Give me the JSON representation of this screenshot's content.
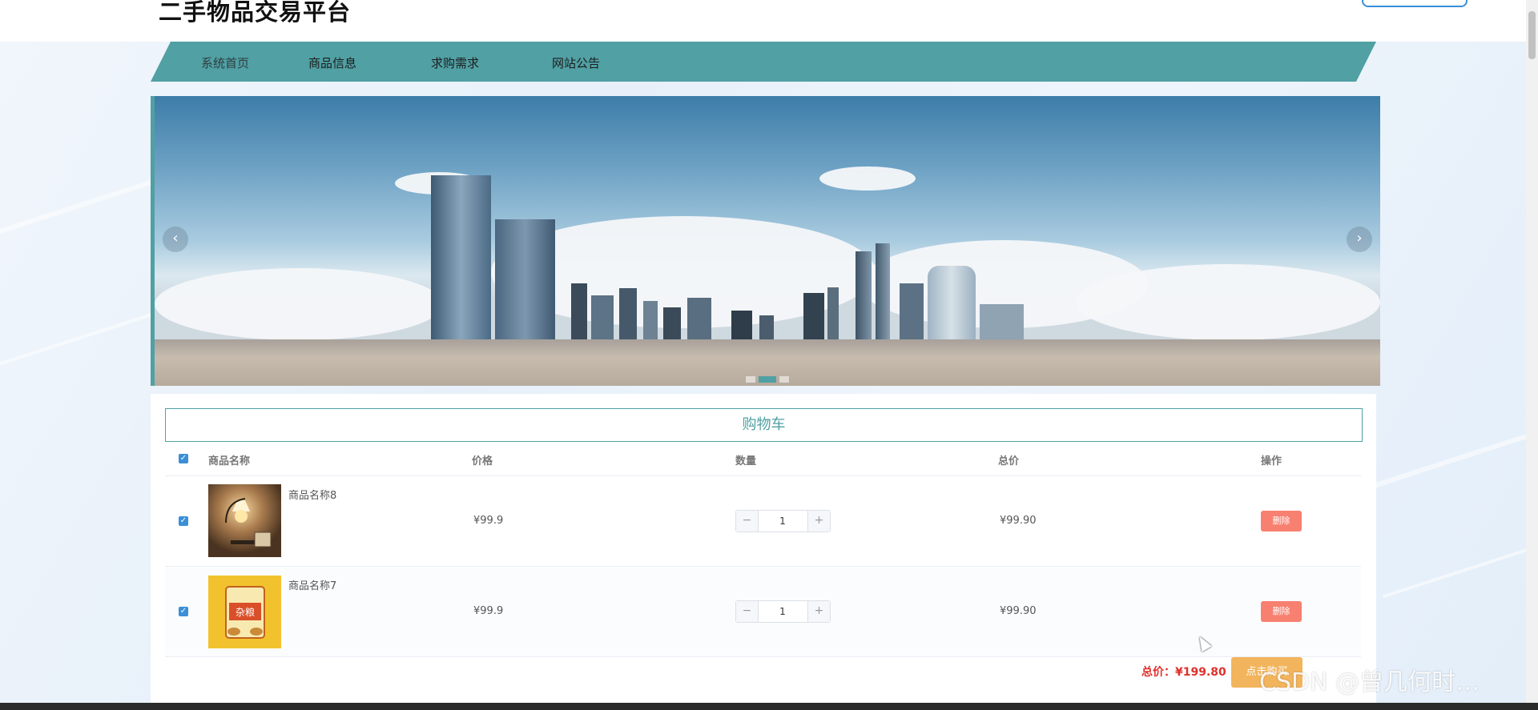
{
  "header": {
    "site_title": "二手物品交易平台"
  },
  "nav": {
    "items": [
      {
        "label": "系统首页"
      },
      {
        "label": "商品信息"
      },
      {
        "label": "求购需求"
      },
      {
        "label": "网站公告"
      }
    ]
  },
  "banner": {
    "prev_icon": "‹",
    "next_icon": "›",
    "slide_count": 3,
    "active_slide": 2
  },
  "cart": {
    "title": "购物车",
    "columns": [
      "商品名称",
      "价格",
      "数量",
      "总价",
      "操作"
    ],
    "items": [
      {
        "name": "商品名称8",
        "price": "¥99.9",
        "quantity": "1",
        "subtotal": "¥99.90",
        "delete_label": "删除",
        "checked": true
      },
      {
        "name": "商品名称7",
        "price": "¥99.9",
        "quantity": "1",
        "subtotal": "¥99.90",
        "delete_label": "删除",
        "checked": true
      }
    ],
    "total_label": "总价：",
    "total_value": "¥199.80",
    "buy_label": "点击购买"
  },
  "watermark": "CSDN @曾几何时…",
  "colors": {
    "accent": "#50a0a4",
    "checkbox": "#3a8fd8",
    "delete": "#f78070",
    "buy": "#f2b45c",
    "total": "#e0302a"
  }
}
